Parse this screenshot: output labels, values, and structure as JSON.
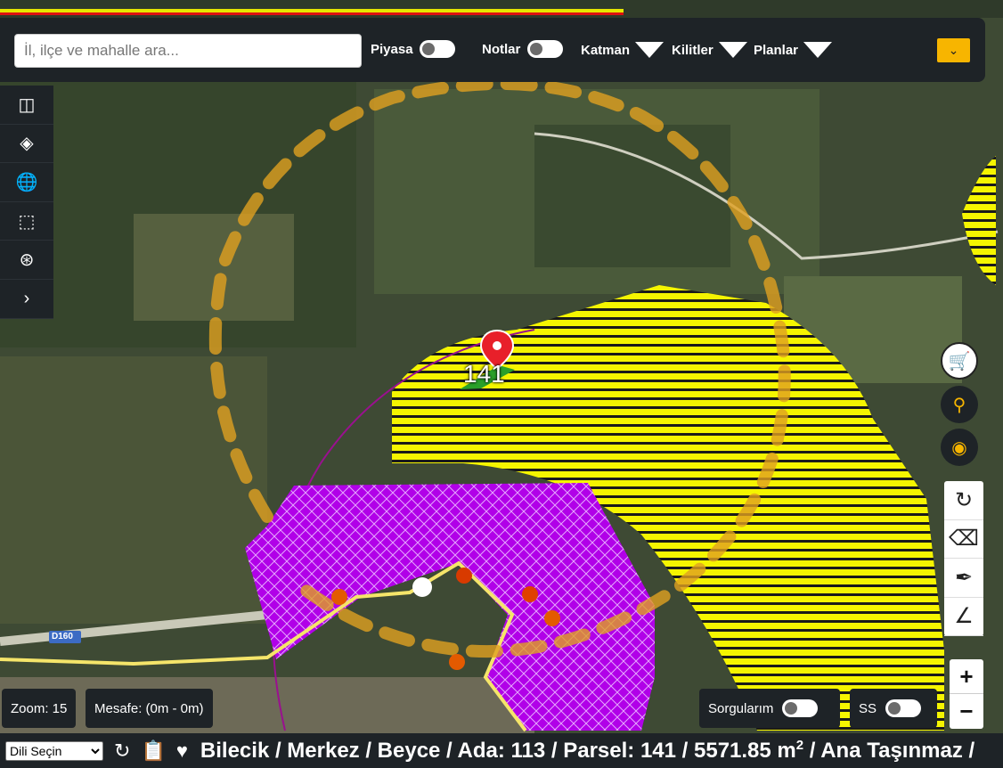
{
  "search": {
    "placeholder": "İl, ilçe ve mahalle ara..."
  },
  "toggles": {
    "piyasa": "Piyasa",
    "notlar": "Notlar"
  },
  "menus": {
    "katman": "Katman",
    "kilitler": "Kilitler",
    "planlar": "Planlar"
  },
  "map": {
    "parcel_label": "141",
    "road_label": "D160"
  },
  "bottom": {
    "zoom": "Zoom: 15",
    "mesafe": "Mesafe: (0m - 0m)",
    "sorgularim": "Sorgularım",
    "ss": "SS"
  },
  "zoom_controls": {
    "plus": "+",
    "minus": "−"
  },
  "status": {
    "language": "Dili Seçin",
    "path": "Bilecik / Merkez / Beyce / Ada: 113 / Parsel: 141 / 5571.85 m",
    "path_sup": "2",
    "path_tail": " / Ana Taşınmaz /"
  },
  "colors": {
    "accent": "#f7b500",
    "panel": "#1e2327",
    "zone_yellow": "#ffff00",
    "zone_purple": "#b000e0",
    "marker": "#e8202a"
  }
}
